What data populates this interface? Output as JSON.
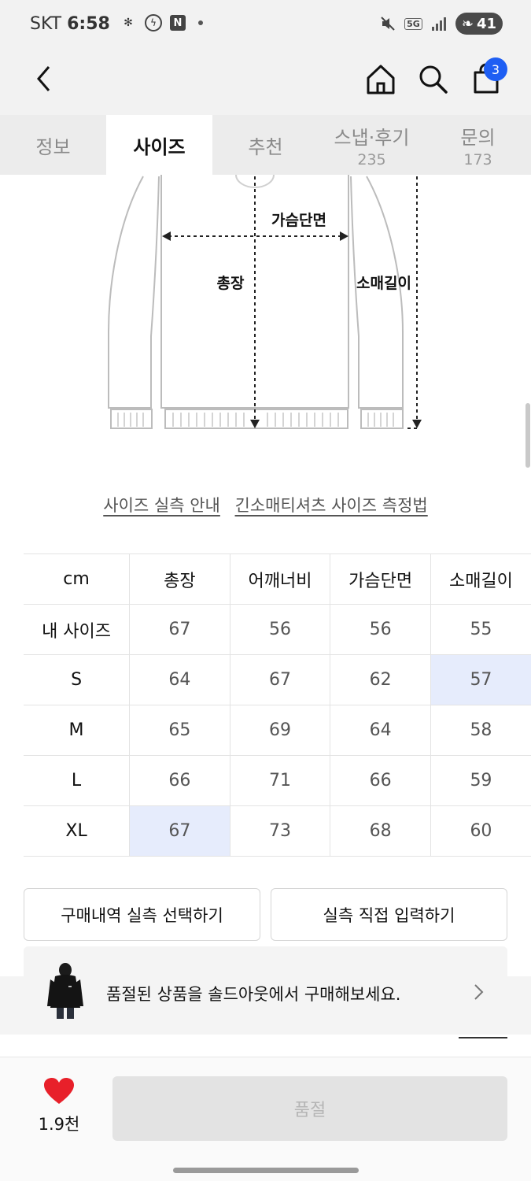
{
  "status_bar": {
    "carrier": "SKT",
    "time": "6:58",
    "network": "5G",
    "battery": "41"
  },
  "header": {
    "back_icon": "chevron-left-icon",
    "home_icon": "home-icon",
    "search_icon": "search-icon",
    "cart_icon": "shopping-bag-icon",
    "cart_count": "3"
  },
  "tabs": [
    {
      "label": "정보",
      "count": ""
    },
    {
      "label": "사이즈",
      "count": ""
    },
    {
      "label": "추천",
      "count": ""
    },
    {
      "label": "스냅·후기",
      "count": "235"
    },
    {
      "label": "문의",
      "count": "173"
    }
  ],
  "active_tab_index": 1,
  "diagram": {
    "chest_label": "가슴단면",
    "length_label": "총장",
    "sleeve_label": "소매길이"
  },
  "links": {
    "size_guide": "사이즈 실측 안내",
    "measure_method": "긴소매티셔츠 사이즈 측정법"
  },
  "size_table": {
    "headers": [
      "cm",
      "총장",
      "어깨너비",
      "가슴단면",
      "소매길이"
    ],
    "rows": [
      [
        "내 사이즈",
        "67",
        "56",
        "56",
        "55"
      ],
      [
        "S",
        "64",
        "67",
        "62",
        "57"
      ],
      [
        "M",
        "65",
        "69",
        "64",
        "58"
      ],
      [
        "L",
        "66",
        "71",
        "66",
        "59"
      ],
      [
        "XL",
        "67",
        "73",
        "68",
        "60"
      ]
    ],
    "highlight_color": "#e6ecfc"
  },
  "buttons": {
    "purchase_history": "구매내역 실측 선택하기",
    "direct_input": "실측 직접 입력하기"
  },
  "banner": {
    "text": "품절된 상품을 솔드아웃에서 구매해보세요."
  },
  "bottom": {
    "like_count": "1.9천",
    "soldout_label": "품절",
    "heart_color": "#e8202a"
  },
  "colors": {
    "accent": "#1e5ef3"
  }
}
